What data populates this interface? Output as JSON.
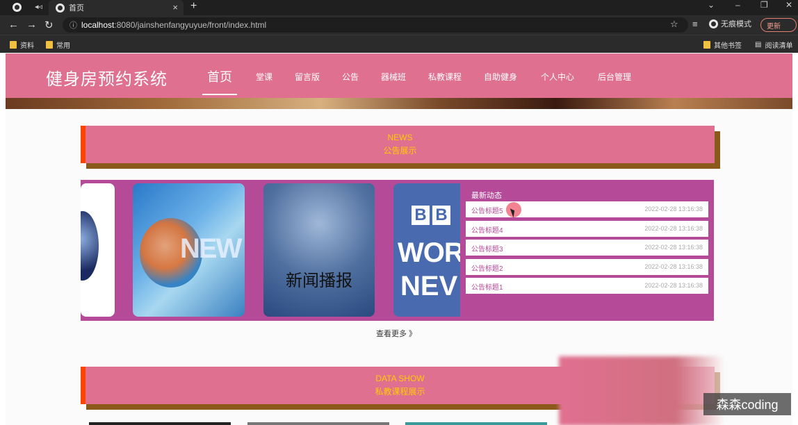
{
  "browser": {
    "tab_title": "首页",
    "url_host": "localhost",
    "url_rest": ":8080/jainshenfangyuyue/front/index.html",
    "incognito_label": "无痕模式",
    "update_label": "更新",
    "bookmarks": [
      "资料",
      "常用"
    ],
    "bookmarks_right": [
      "其他书签",
      "阅读清单"
    ]
  },
  "site": {
    "logo": "健身房预约系统",
    "nav": [
      "首页",
      "堂课",
      "留言版",
      "公告",
      "器械班",
      "私教课程",
      "自助健身",
      "个人中心",
      "后台管理"
    ]
  },
  "news_section": {
    "en": "NEWS",
    "cn": "公告展示"
  },
  "carousel": {
    "card3_text": "新闻播报",
    "card4_line1": "BB",
    "card4_line2": "WOR",
    "card4_line3": "NEV"
  },
  "latest": {
    "title": "最新动态",
    "items": [
      {
        "title": "公告标题5",
        "date": "2022-02-28 13:16:38"
      },
      {
        "title": "公告标题4",
        "date": "2022-02-28 13:16:38"
      },
      {
        "title": "公告标题3",
        "date": "2022-02-28 13:16:38"
      },
      {
        "title": "公告标题2",
        "date": "2022-02-28 13:16:38"
      },
      {
        "title": "公告标题1",
        "date": "2022-02-28 13:16:38"
      }
    ]
  },
  "more_label": "查看更多 》",
  "data_section": {
    "en": "DATA SHOW",
    "cn": "私教课程展示"
  },
  "watermark": "森森coding",
  "colors": {
    "accent": "#e07090",
    "panel": "#b44a98",
    "title_yellow": "#ffcc00",
    "left_border": "#ff4400",
    "shadow": "#8b5a1a"
  }
}
